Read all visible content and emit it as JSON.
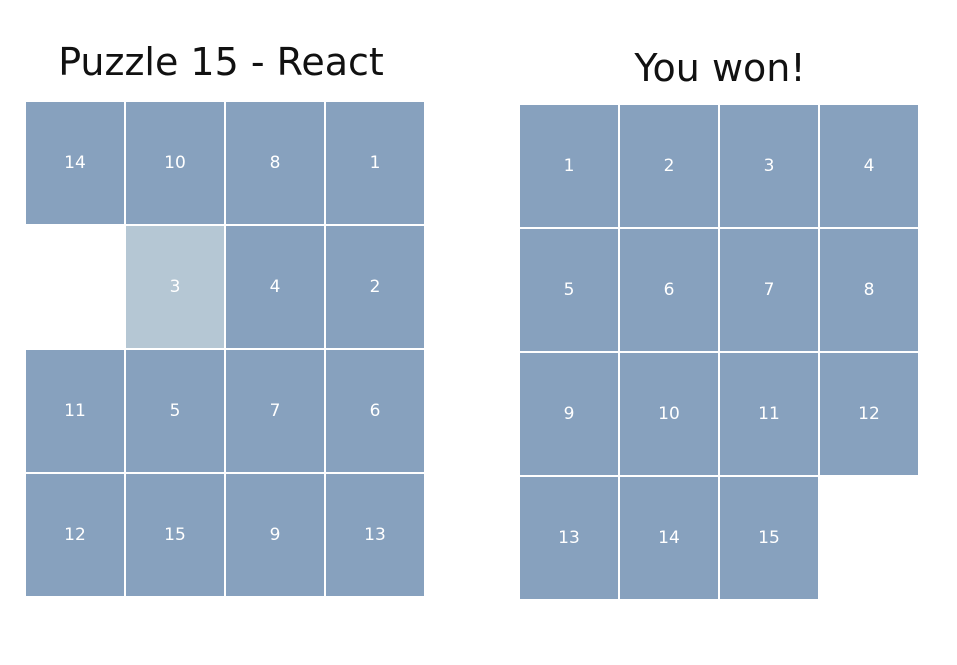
{
  "left_game": {
    "title": "Puzzle 15 - React",
    "grid": [
      [
        "14",
        "10",
        "8",
        "1"
      ],
      [
        "",
        "3",
        "4",
        "2"
      ],
      [
        "11",
        "5",
        "7",
        "6"
      ],
      [
        "12",
        "15",
        "9",
        "13"
      ]
    ],
    "highlighted_tile": "3"
  },
  "right_game": {
    "title": "You won!",
    "grid": [
      [
        "1",
        "2",
        "3",
        "4"
      ],
      [
        "5",
        "6",
        "7",
        "8"
      ],
      [
        "9",
        "10",
        "11",
        "12"
      ],
      [
        "13",
        "14",
        "15",
        ""
      ]
    ]
  },
  "colors": {
    "tile": "#87a1be",
    "tile_highlight": "#b5c7d4",
    "tile_text": "#ffffff",
    "background": "#ffffff"
  }
}
